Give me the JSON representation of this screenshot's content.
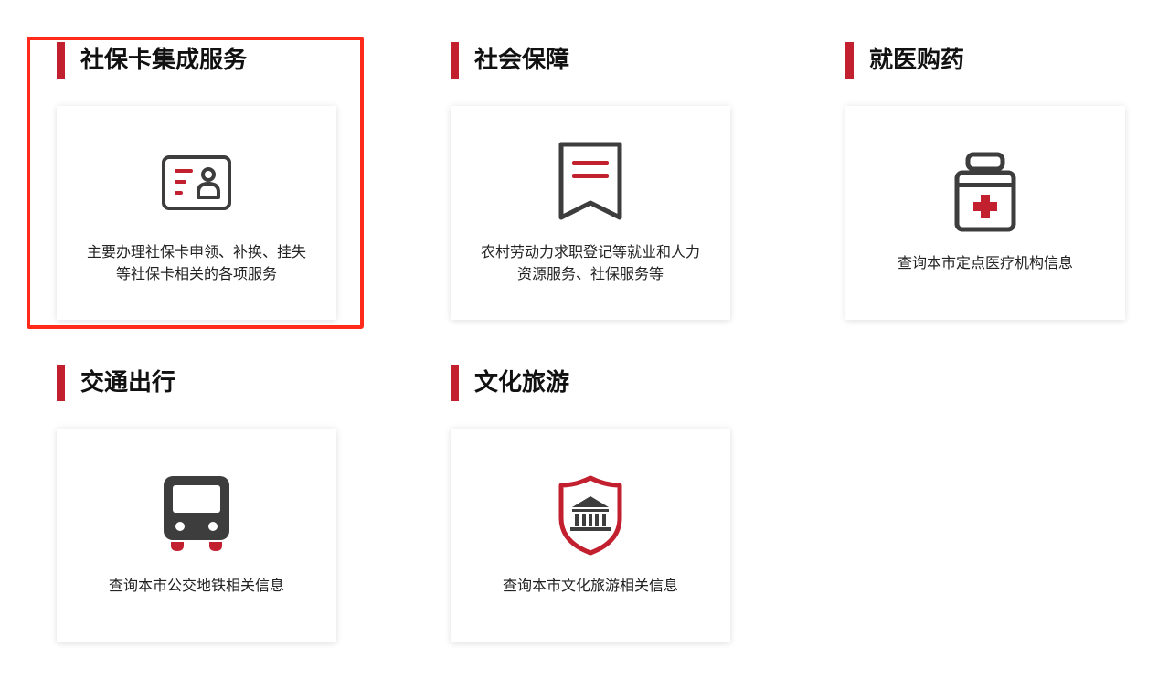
{
  "sections": [
    {
      "title": "社保卡集成服务",
      "description_lines": [
        "主要办理社保卡申领、补换、挂失",
        "等社保卡相关的各项服务"
      ],
      "icon": "id-card-icon"
    },
    {
      "title": "社会保障",
      "description_lines": [
        "农村劳动力求职登记等就业和人力",
        "资源服务、社保服务等"
      ],
      "icon": "bookmark-icon"
    },
    {
      "title": "就医购药",
      "description_lines": [
        "查询本市定点医疗机构信息"
      ],
      "icon": "medicine-bottle-icon"
    },
    {
      "title": "交通出行",
      "description_lines": [
        "查询本市公交地铁相关信息"
      ],
      "icon": "bus-icon"
    },
    {
      "title": "文化旅游",
      "description_lines": [
        "查询本市文化旅游相关信息"
      ],
      "icon": "museum-shield-icon"
    }
  ],
  "colors": {
    "accent": "#c21f2f",
    "icon_dark": "#3d3d3d",
    "highlight": "#ff2a1a",
    "text": "#111111"
  }
}
